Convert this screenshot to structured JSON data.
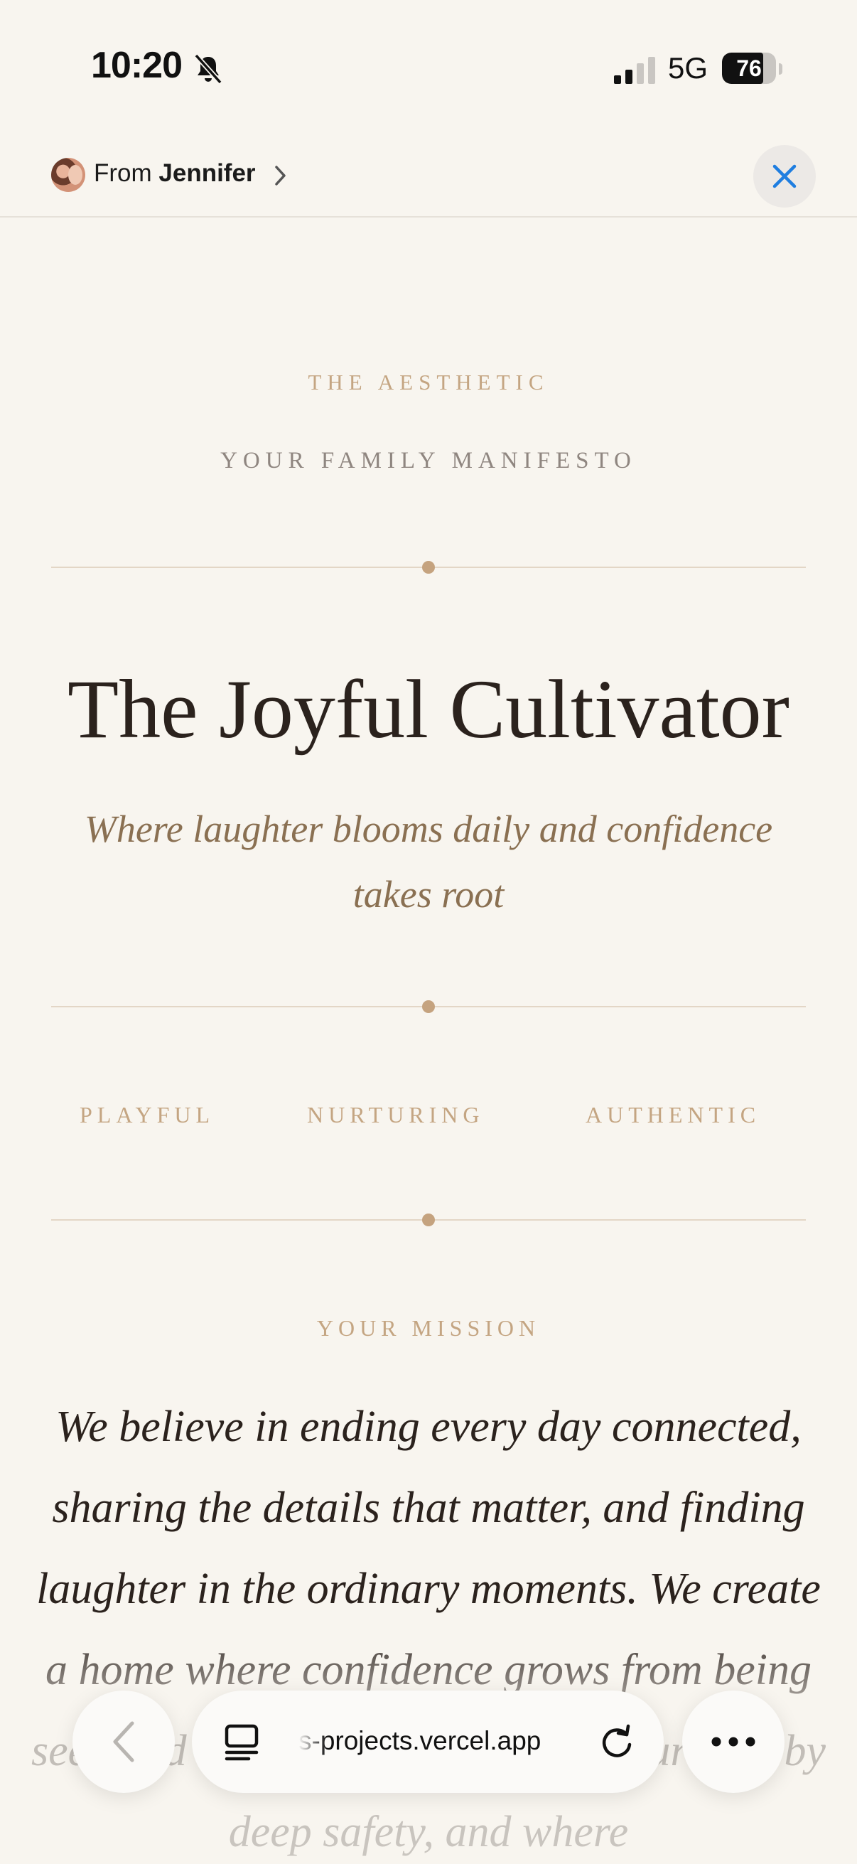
{
  "status_bar": {
    "time": "10:20",
    "network": "5G",
    "battery_level": "76",
    "battery_fraction": 0.76,
    "icons": [
      "bell-slash-icon",
      "signal-icon",
      "battery-icon"
    ]
  },
  "share_header": {
    "from_prefix": "From",
    "from_name": "Jennifer",
    "icons": [
      "avatar",
      "chevron-right-icon",
      "close-icon"
    ],
    "accent_color": "#1f7ee0"
  },
  "manifesto": {
    "kicker": "THE AESTHETIC",
    "subkicker": "YOUR FAMILY MANIFESTO",
    "title": "The Joyful Cultivator",
    "tagline": "Where laughter blooms daily and confidence takes root",
    "values": [
      "PLAYFUL",
      "NURTURING",
      "AUTHENTIC"
    ],
    "mission_label": "YOUR MISSION",
    "mission_text": "We believe in ending every day connected, sharing the details that matter, and finding laughter in the ordinary moments. We create a home where confidence grows from being seen and heard, where play is encouraged by deep safety, and where",
    "colors": {
      "gold": "#c4a582",
      "ink": "#2b221d",
      "tagline": "#8a7052",
      "background": "#f8f5ef"
    }
  },
  "browser_toolbar": {
    "url": "s-projects.vercel.app",
    "icons": [
      "back-chevron-icon",
      "tabs-icon",
      "reload-icon",
      "more-icon"
    ]
  }
}
